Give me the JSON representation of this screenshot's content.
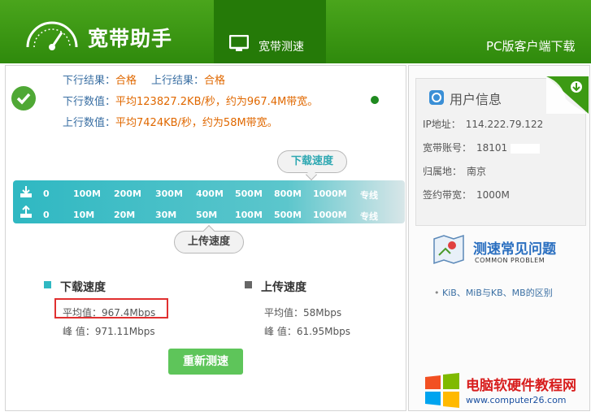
{
  "header": {
    "app_title": "宽带助手",
    "tab_label": "宽带测速",
    "pc_link": "PC版客户端下载"
  },
  "result": {
    "down_result_label": "下行结果：",
    "down_result_value": "合格",
    "up_result_label": "上行结果：",
    "up_result_value": "合格",
    "down_value_label": "下行数值：",
    "down_value_text": "平均123827.2KB/秒，约为967.4M带宽。",
    "up_value_label": "上行数值：",
    "up_value_text": "平均7424KB/秒，约为58M带宽。"
  },
  "scale": {
    "download_label": "下载速度",
    "upload_label": "上传速度",
    "download_ticks": [
      "0",
      "100M",
      "200M",
      "300M",
      "400M",
      "500M",
      "800M",
      "1000M",
      "专线"
    ],
    "upload_ticks": [
      "0",
      "10M",
      "20M",
      "30M",
      "50M",
      "100M",
      "500M",
      "1000M",
      "专线"
    ]
  },
  "stats": {
    "download_title": "下载速度",
    "download_avg": "平均值：967.4Mbps",
    "download_peak": "峰 值：971.11Mbps",
    "upload_title": "上传速度",
    "upload_avg": "平均值：58Mbps",
    "upload_peak": "峰 值：61.95Mbps"
  },
  "retest_label": "重新测速",
  "user_info": {
    "title": "用户信息",
    "ip_label": "IP地址：",
    "ip_value": "114.222.79.122",
    "account_label": "宽带账号：",
    "account_value": "18101",
    "region_label": "归属地：",
    "region_value": "南京",
    "bandwidth_label": "签约带宽：",
    "bandwidth_value": "1000M"
  },
  "faq": {
    "title": "测速常见问题",
    "subtitle": "COMMON PROBLEM",
    "item": "KiB、MiB与KB、MB的区别"
  },
  "watermark": {
    "title": "电脑软硬件教程网",
    "url": "www.computer26.com"
  },
  "colors": {
    "header": "#3c9a14",
    "accent_orange": "#e06800",
    "blue_text": "#3a6fa3",
    "scale": "#2fb8c2",
    "button": "#5ec55a",
    "highlight": "#e03030"
  }
}
